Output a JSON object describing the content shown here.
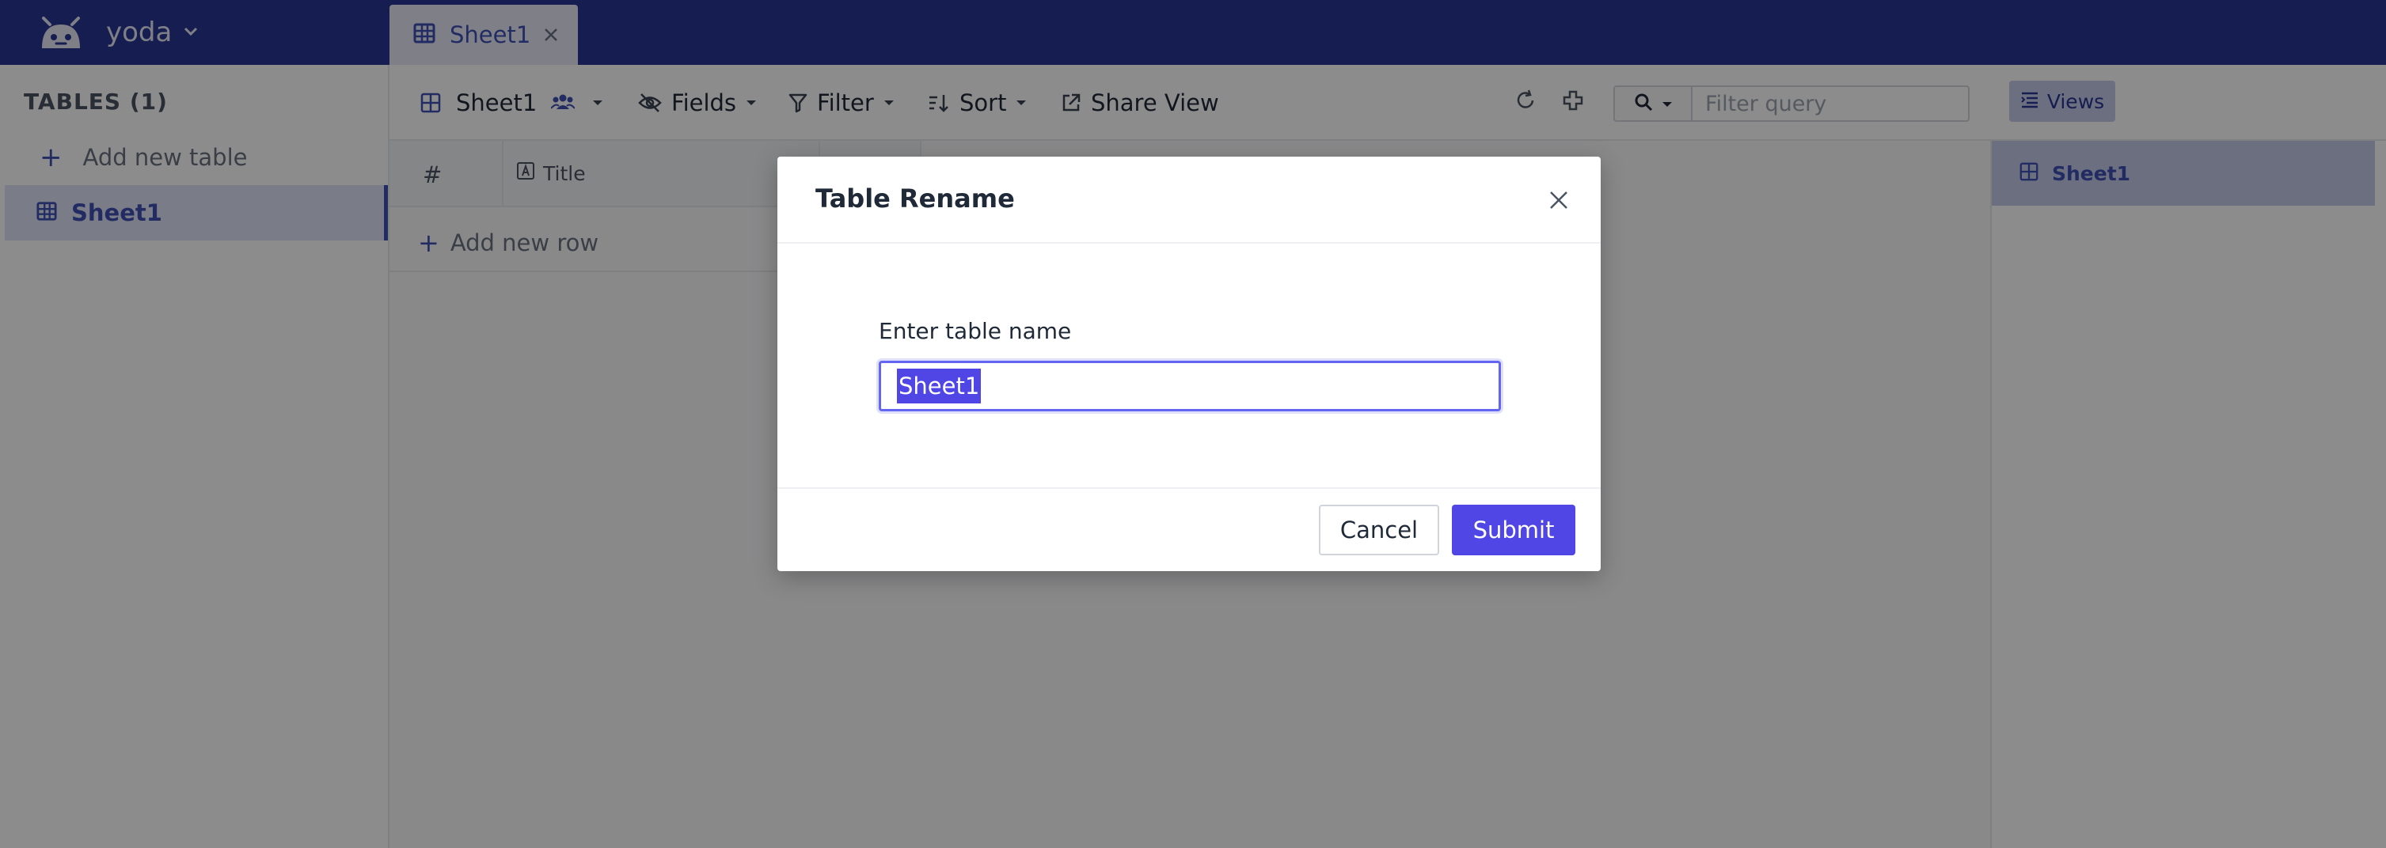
{
  "topbar": {
    "project_name": "yoda",
    "active_tab": {
      "label": "Sheet1",
      "icon": "table-icon"
    },
    "colors": {
      "bar": "#283593",
      "accent": "#3f51b5"
    }
  },
  "sidebar": {
    "heading": "TABLES (1)",
    "add_table_label": "Add new table",
    "tables": [
      {
        "label": "Sheet1",
        "selected": true
      }
    ]
  },
  "toolbar": {
    "view_name": "Sheet1",
    "fields_label": "Fields",
    "filter_label": "Filter",
    "sort_label": "Sort",
    "share_label": "Share View",
    "filter_query_placeholder": "Filter query",
    "views_label": "Views"
  },
  "grid": {
    "columns": [
      {
        "label": "#"
      },
      {
        "label": "Title",
        "type_icon": "text-field-icon"
      }
    ],
    "add_row_label": "Add new row"
  },
  "views_panel": {
    "views": [
      {
        "label": "Sheet1",
        "selected": true
      }
    ]
  },
  "modal": {
    "title": "Table Rename",
    "field_label": "Enter table name",
    "input_value": "Sheet1",
    "cancel_label": "Cancel",
    "submit_label": "Submit",
    "colors": {
      "primary": "#4f46e5"
    }
  }
}
